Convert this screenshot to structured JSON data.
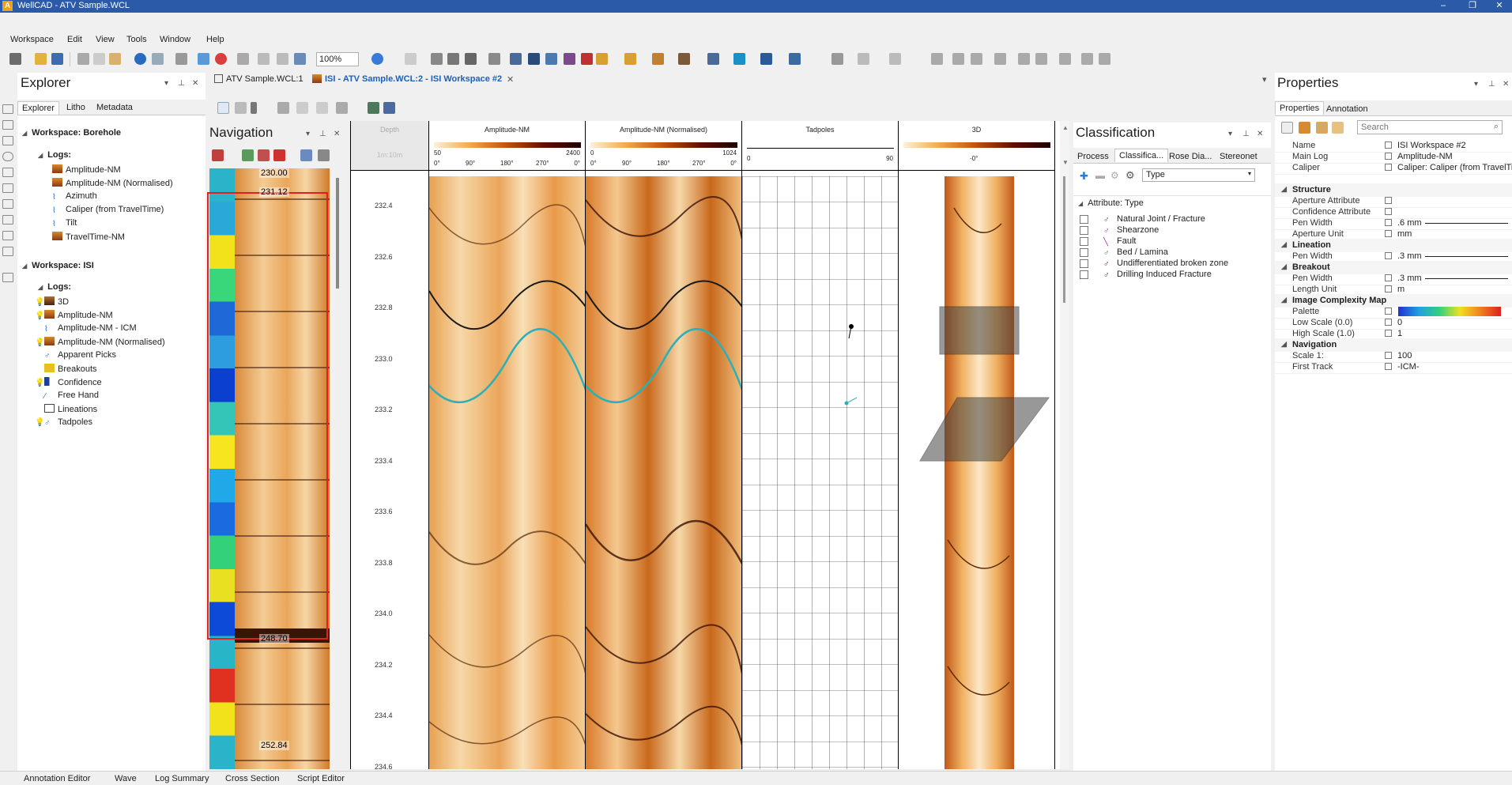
{
  "window": {
    "title": "WellCAD - ATV Sample.WCL",
    "minimize": "–",
    "restore": "❐",
    "close": "✕"
  },
  "menu": [
    "Workspace",
    "Edit",
    "View",
    "Tools",
    "Window",
    "Help"
  ],
  "toolbar": {
    "zoom": "100%"
  },
  "explorer": {
    "title": "Explorer",
    "tabs": [
      "Explorer",
      "Litho",
      "Metadata"
    ],
    "workspace1": {
      "label": "Workspace: Borehole",
      "logs_label": "Logs:",
      "logs": [
        "Amplitude-NM",
        "Amplitude-NM (Normalised)",
        "Azimuth",
        "Caliper (from TravelTime)",
        "Tilt",
        "TravelTime-NM"
      ]
    },
    "workspace2": {
      "label": "Workspace: ISI",
      "logs_label": "Logs:",
      "logs": [
        "3D",
        "Amplitude-NM",
        "Amplitude-NM - ICM",
        "Amplitude-NM (Normalised)",
        "Apparent Picks",
        "Breakouts",
        "Confidence",
        "Free Hand",
        "Lineations",
        "Tadpoles"
      ]
    }
  },
  "doc_tabs": [
    "ATV Sample.WCL:1",
    "ISI - ATV Sample.WCL:2 - ISI Workspace #2"
  ],
  "navigation": {
    "title": "Navigation",
    "labels": [
      "230.00",
      "231.12",
      "248.70",
      "252.84"
    ]
  },
  "logview": {
    "depth_header": "Depth",
    "depth_scale": "1m:10m",
    "depths": [
      "232.4",
      "232.6",
      "232.8",
      "233.0",
      "233.2",
      "233.4",
      "233.6",
      "233.8",
      "234.0",
      "234.2",
      "234.4",
      "234.6"
    ],
    "tracks": [
      {
        "name": "Amplitude-NM",
        "min": "50",
        "max": "2400",
        "angles": [
          "0°",
          "90°",
          "180°",
          "270°",
          "0°"
        ]
      },
      {
        "name": "Amplitude-NM (Normalised)",
        "min": "0",
        "max": "1024",
        "angles": [
          "0°",
          "90°",
          "180°",
          "270°",
          "0°"
        ]
      },
      {
        "name": "Tadpoles",
        "min": "0",
        "max": "90"
      },
      {
        "name": "3D",
        "center": "-0°"
      }
    ]
  },
  "classification": {
    "title": "Classification",
    "tabs": [
      "Process",
      "Classifica...",
      "Rose Dia...",
      "Stereonet"
    ],
    "filter": "Type",
    "group": "Attribute: Type",
    "items": [
      "Natural Joint / Fracture",
      "Shearzone",
      "Fault",
      "Bed / Lamina",
      "Undifferentiated broken zone",
      "Drilling Induced Fracture"
    ]
  },
  "properties": {
    "title": "Properties",
    "tabs": [
      "Properties",
      "Annotation"
    ],
    "search_placeholder": "Search",
    "rows_top": [
      {
        "name": "Name",
        "value": "ISI Workspace #2"
      },
      {
        "name": "Main Log",
        "value": "Amplitude-NM"
      },
      {
        "name": "Caliper",
        "value": "Caliper: Caliper (from TravelTime) [mm]"
      }
    ],
    "sections": [
      {
        "title": "Structure",
        "rows": [
          {
            "name": "Aperture Attribute",
            "value": ""
          },
          {
            "name": "Confidence Attribute",
            "value": ""
          },
          {
            "name": "Pen Width",
            "value": ".6 mm"
          },
          {
            "name": "Aperture Unit",
            "value": "mm"
          }
        ]
      },
      {
        "title": "Lineation",
        "rows": [
          {
            "name": "Pen Width",
            "value": ".3 mm"
          }
        ]
      },
      {
        "title": "Breakout",
        "rows": [
          {
            "name": "Pen Width",
            "value": ".3 mm"
          },
          {
            "name": "Length Unit",
            "value": "m"
          }
        ]
      },
      {
        "title": "Image Complexity Map",
        "rows": [
          {
            "name": "Palette",
            "value": ""
          },
          {
            "name": "Low Scale (0.0)",
            "value": "0"
          },
          {
            "name": "High Scale (1.0)",
            "value": "1"
          }
        ]
      },
      {
        "title": "Navigation",
        "rows": [
          {
            "name": "Scale 1:",
            "value": "100"
          },
          {
            "name": "First Track",
            "value": "-ICM-"
          }
        ]
      }
    ]
  },
  "status_tabs": [
    "Annotation Editor",
    "Wave",
    "Log Summary",
    "Cross Section",
    "Script Editor"
  ],
  "colors": {
    "titlebar": "#2a5aa8",
    "accent": "#1f5fb4",
    "selection": "#e02020"
  }
}
